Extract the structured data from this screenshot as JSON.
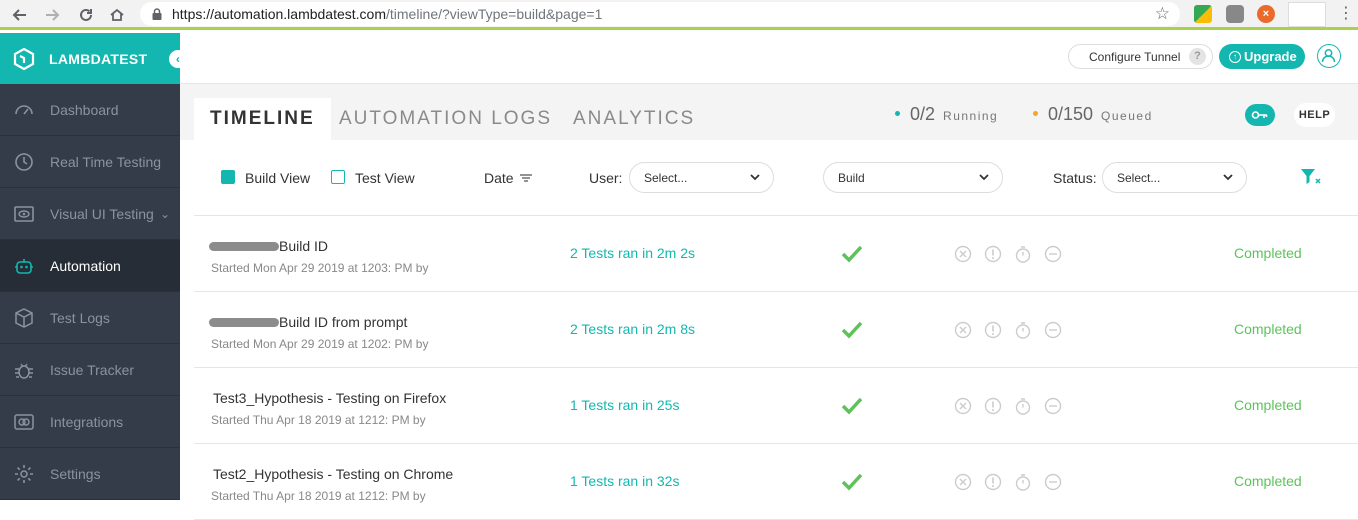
{
  "browser": {
    "url_host": "https://automation.lambdatest.com",
    "url_path": "/timeline/?viewType=build&page=1"
  },
  "sidebar": {
    "brand": "LAMBDATEST",
    "items": [
      {
        "label": "Dashboard",
        "icon": "gauge-icon"
      },
      {
        "label": "Real Time Testing",
        "icon": "clock-icon"
      },
      {
        "label": "Visual UI Testing",
        "icon": "eye-icon"
      },
      {
        "label": "Automation",
        "icon": "robot-icon",
        "active": true
      },
      {
        "label": "Test Logs",
        "icon": "cube-icon"
      },
      {
        "label": "Issue Tracker",
        "icon": "bug-icon"
      },
      {
        "label": "Integrations",
        "icon": "plug-icon"
      },
      {
        "label": "Settings",
        "icon": "gear-icon"
      }
    ]
  },
  "header": {
    "configure_tunnel": "Configure Tunnel",
    "help_q": "?",
    "upgrade": "Upgrade"
  },
  "tabs": [
    "TIMELINE",
    "AUTOMATION LOGS",
    "ANALYTICS"
  ],
  "stats": {
    "running_value": "0/2",
    "running_label": "Running",
    "queued_value": "0/150",
    "queued_label": "Queued"
  },
  "help_label": "HELP",
  "filters": {
    "build_view": "Build View",
    "test_view": "Test View",
    "date": "Date",
    "user_label": "User:",
    "user_select": "Select...",
    "build_select": "Build",
    "status_label": "Status:",
    "status_select": "Select..."
  },
  "rows": [
    {
      "name": "Build ID",
      "redacted_prefix": true,
      "started": "Started Mon Apr 29 2019 at 1203: PM by",
      "tests": "2 Tests ran in 2m 2s",
      "status": "Completed"
    },
    {
      "name": "Build ID from prompt",
      "redacted_prefix": true,
      "started": "Started Mon Apr 29 2019 at 1202: PM by",
      "tests": "2 Tests ran in 2m 8s",
      "status": "Completed"
    },
    {
      "name": "Test3_Hypothesis - Testing on Firefox",
      "redacted_prefix": false,
      "started": "Started Thu Apr 18 2019 at 1212: PM by",
      "tests": "1 Tests ran in 25s",
      "status": "Completed"
    },
    {
      "name": "Test2_Hypothesis - Testing on Chrome",
      "redacted_prefix": false,
      "started": "Started Thu Apr 18 2019 at 1212: PM by",
      "tests": "1 Tests ran in 32s",
      "status": "Completed"
    }
  ],
  "colors": {
    "brand": "#13b7b0",
    "sidebar": "#333c48",
    "success": "#5cc35a",
    "running_dot": "#13b7b0",
    "queued_dot": "#f5a623"
  }
}
